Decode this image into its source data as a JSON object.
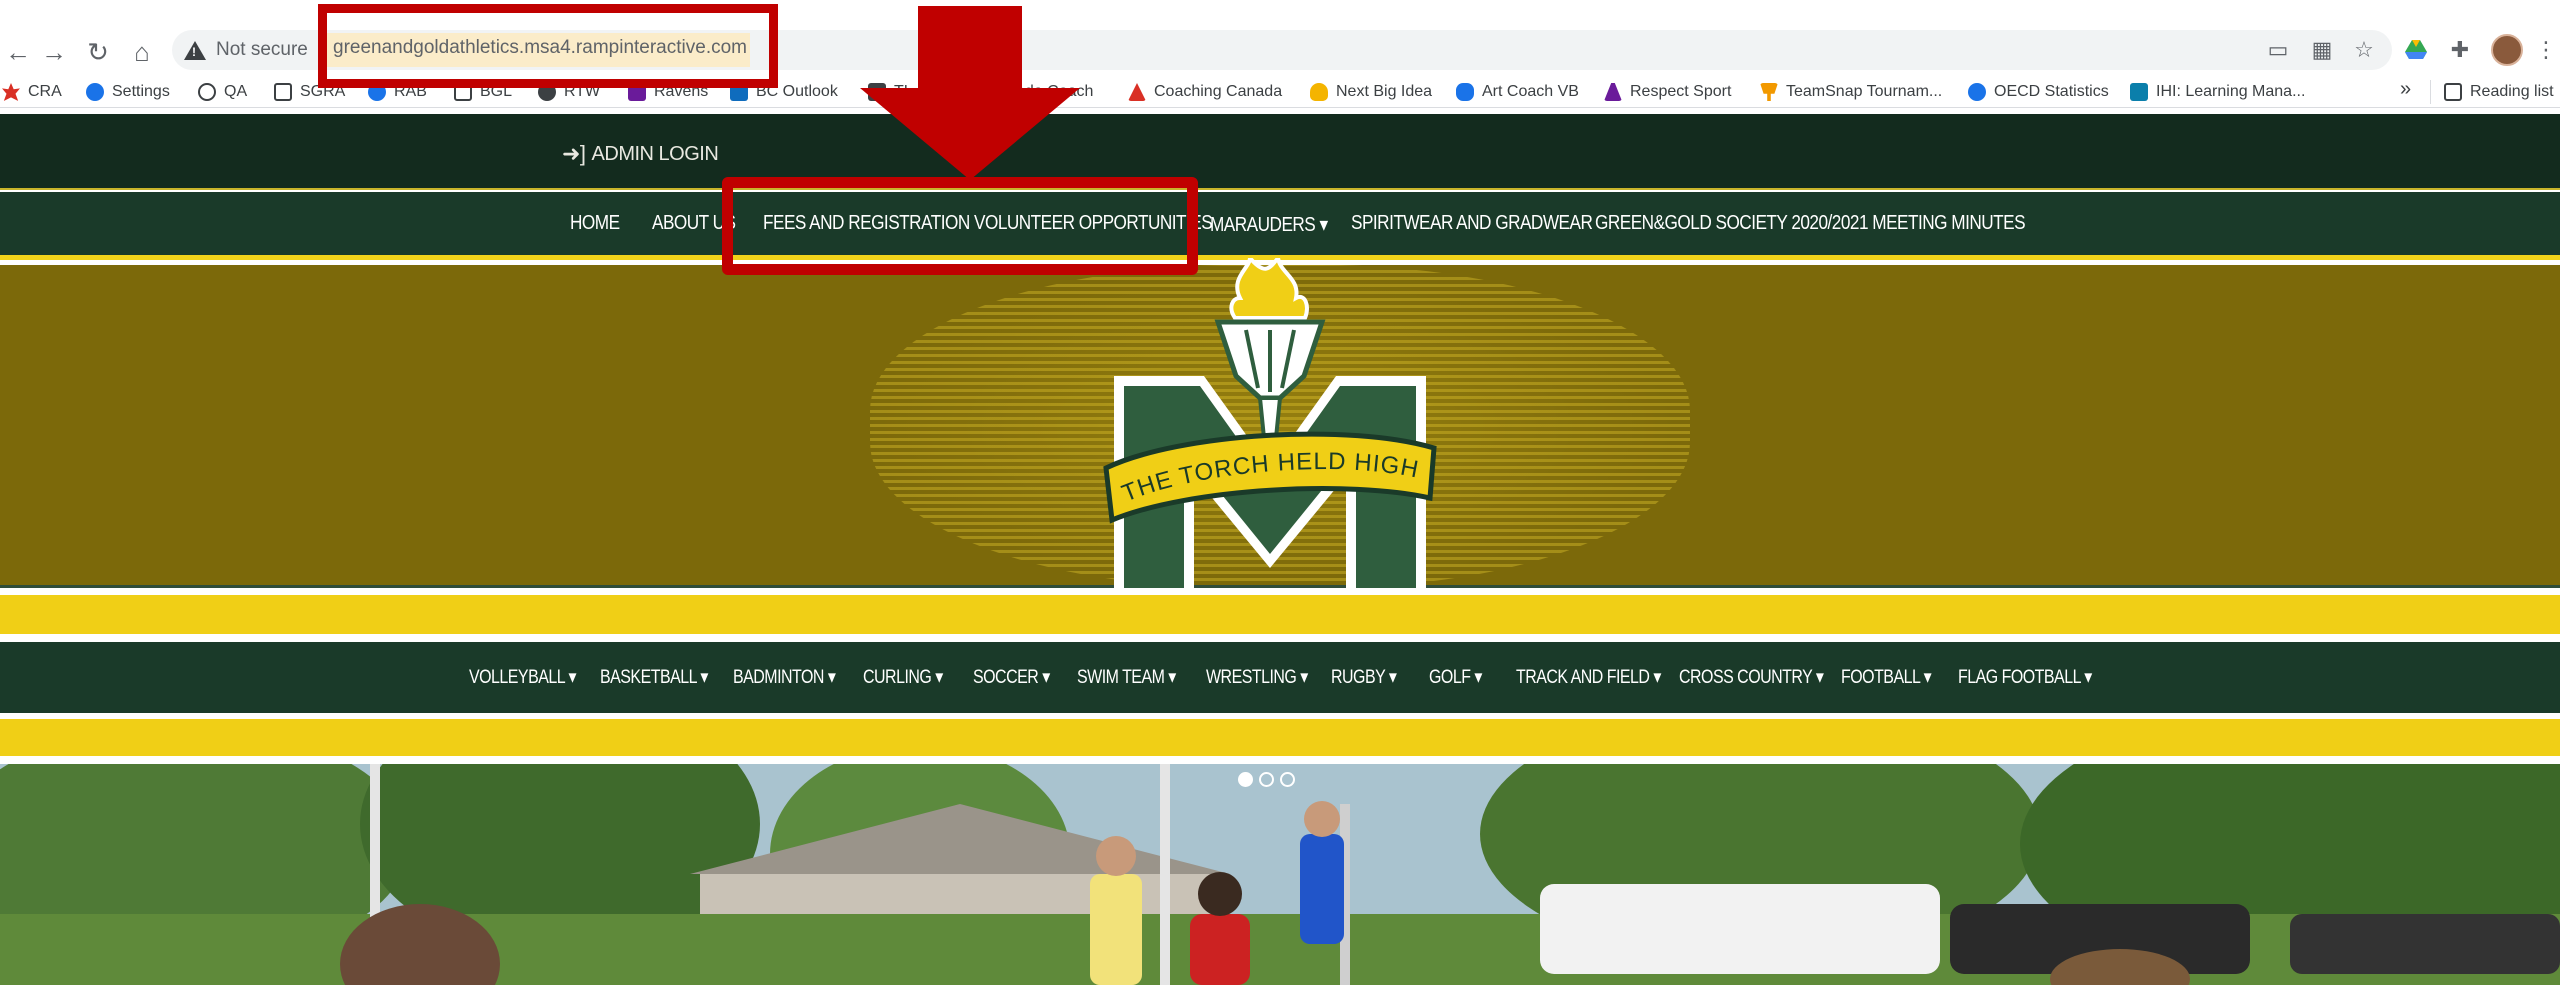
{
  "browser": {
    "security_label": "Not secure",
    "url": "greenandgoldathletics.msa4.rampinteractive.com",
    "reading_list": "Reading list",
    "more_bookmarks": "»"
  },
  "bookmarks": [
    {
      "label": "CRA",
      "color": "#d93025"
    },
    {
      "label": "Settings",
      "color": "#1a73e8"
    },
    {
      "label": "QA",
      "color": "#3c4043"
    },
    {
      "label": "SGRA",
      "color": "#3c4043"
    },
    {
      "label": "RAB",
      "color": "#1a73e8"
    },
    {
      "label": "BGL",
      "color": "#3c4043"
    },
    {
      "label": "RTW",
      "color": "#3c4043"
    },
    {
      "label": "Ravens",
      "color": "#6a1b9a"
    },
    {
      "label": "BC Outlook",
      "color": "#0f6cbd"
    },
    {
      "label": "TL",
      "color": "#3c4043"
    },
    {
      "label": "ada Coach",
      "color": "#d93025"
    },
    {
      "label": "Coaching Canada",
      "color": "#d93025"
    },
    {
      "label": "Next Big Idea",
      "color": "#f4b400"
    },
    {
      "label": "Art Coach VB",
      "color": "#1a73e8"
    },
    {
      "label": "Respect Sport",
      "color": "#6a1b9a"
    },
    {
      "label": "TeamSnap Tournam...",
      "color": "#f29900"
    },
    {
      "label": "OECD Statistics",
      "color": "#1a73e8"
    },
    {
      "label": "IHI: Learning Mana...",
      "color": "#0b7fab"
    }
  ],
  "site": {
    "admin_login": "ADMIN LOGIN",
    "main_nav": [
      "HOME",
      "ABOUT US",
      "FEES AND REGISTRATION",
      "VOLUNTEER OPPORTUNITIES",
      "MARAUDERS ▾",
      "SPIRITWEAR AND GRADWEAR",
      "GREEN&GOLD SOCIETY 2020/2021 MEETING MINUTES"
    ],
    "logo_motto": "THE TORCH HELD HIGH",
    "sports_nav": [
      "VOLLEYBALL ▾",
      "BASKETBALL ▾",
      "BADMINTON ▾",
      "CURLING ▾",
      "SOCCER ▾",
      "SWIM TEAM ▾",
      "WRESTLING ▾",
      "RUGBY ▾",
      "GOLF ▾",
      "TRACK AND FIELD ▾",
      "CROSS COUNTRY ▾",
      "FOOTBALL ▾",
      "FLAG FOOTBALL ▾"
    ],
    "carousel": {
      "slides": 3,
      "active": 1
    },
    "colors": {
      "dark_green": "#1a3a29",
      "gold": "#f0cf16",
      "olive": "#7c690a"
    }
  },
  "annotation": {
    "color": "#c00000"
  }
}
